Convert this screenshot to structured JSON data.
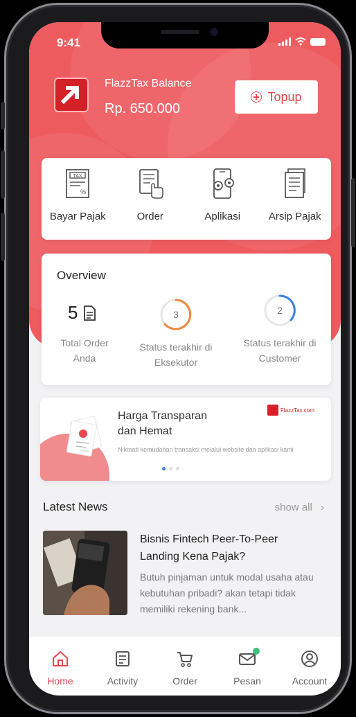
{
  "status_bar": {
    "time": "9:41"
  },
  "balance": {
    "label": "FlazzTax Balance",
    "value": "Rp. 650.000",
    "topup_label": "Topup"
  },
  "menu": [
    {
      "label": "Bayar Pajak",
      "icon": "tax-document-icon"
    },
    {
      "label": "Order",
      "icon": "order-checklist-icon"
    },
    {
      "label": "Aplikasi",
      "icon": "phone-settings-icon"
    },
    {
      "label": "Arsip Pajak",
      "icon": "archive-document-icon"
    }
  ],
  "overview": {
    "title": "Overview",
    "total_order": {
      "count": "5",
      "label": "Total Order Anda"
    },
    "eksekutor": {
      "count": "3",
      "label": "Status terakhir di Eksekutor"
    },
    "customer": {
      "count": "2",
      "label": "Status terakhir di Customer"
    }
  },
  "promo": {
    "title": "Harga Transparan dan Hemat",
    "text": "Nikmati kemudahan transaksi melalui website dan aplikasi kami",
    "brand": "FlazzTax.com",
    "active_slide": 1,
    "slides": 3
  },
  "news": {
    "heading": "Latest News",
    "show_all": "show all",
    "item": {
      "title": "Bisnis Fintech Peer-To-Peer Landing Kena Pajak?",
      "body": "Butuh pinjaman untuk modal usaha atau kebutuhan pribadi? akan tetapi tidak memiliki rekening bank..."
    }
  },
  "tabs": [
    {
      "label": "Home",
      "icon": "home-icon",
      "active": true
    },
    {
      "label": "Activity",
      "icon": "activity-icon",
      "active": false
    },
    {
      "label": "Order",
      "icon": "cart-icon",
      "active": false
    },
    {
      "label": "Pesan",
      "icon": "mail-icon",
      "active": false
    },
    {
      "label": "Account",
      "icon": "account-icon",
      "active": false
    }
  ],
  "colors": {
    "brand": "#ee5b5f",
    "brand_dark": "#d42128",
    "ring_orange": "#f0883e",
    "ring_blue": "#3e7ee6",
    "badge_green": "#3cc27a"
  }
}
